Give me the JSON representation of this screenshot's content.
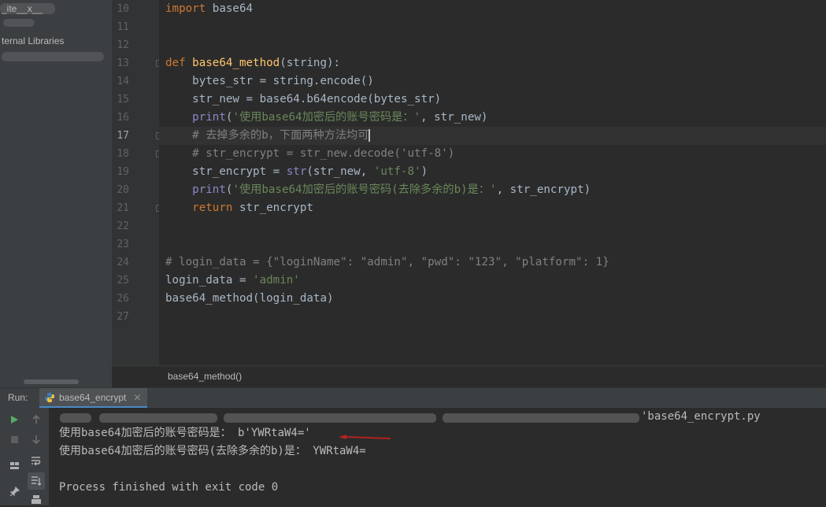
{
  "project_tree": {
    "items": [
      {
        "label": "_ite__x__"
      },
      {
        "label": "ternal Libraries"
      },
      {
        "label": ""
      }
    ]
  },
  "editor": {
    "gutter_numbers": [
      "10",
      "11",
      "12",
      "13",
      "14",
      "15",
      "16",
      "17",
      "18",
      "19",
      "20",
      "21",
      "22",
      "23",
      "24",
      "25",
      "26",
      "27"
    ],
    "current_line": "17",
    "lines": [
      {
        "n": "10",
        "tokens": [
          {
            "t": "import",
            "c": "kw"
          },
          {
            "t": " base64",
            "c": ""
          }
        ]
      },
      {
        "n": "11",
        "tokens": []
      },
      {
        "n": "12",
        "tokens": []
      },
      {
        "n": "13",
        "tokens": [
          {
            "t": "def ",
            "c": "kw"
          },
          {
            "t": "base64_method",
            "c": "fn"
          },
          {
            "t": "(string):",
            "c": ""
          }
        ]
      },
      {
        "n": "14",
        "tokens": [
          {
            "t": "    bytes_str = string.encode()",
            "c": ""
          }
        ]
      },
      {
        "n": "15",
        "tokens": [
          {
            "t": "    str_new = base64.b64encode(bytes_str)",
            "c": ""
          }
        ]
      },
      {
        "n": "16",
        "tokens": [
          {
            "t": "    ",
            "c": ""
          },
          {
            "t": "print",
            "c": "bi"
          },
          {
            "t": "(",
            "c": ""
          },
          {
            "t": "'使用base64加密后的账号密码是：'",
            "c": "str"
          },
          {
            "t": ", str_new)",
            "c": ""
          }
        ]
      },
      {
        "n": "17",
        "tokens": [
          {
            "t": "    # 去掉多余的b，下面两种方法均可",
            "c": "cmt"
          }
        ]
      },
      {
        "n": "18",
        "tokens": [
          {
            "t": "    # str_encrypt = str_new.decode('utf-8')",
            "c": "cmt"
          }
        ]
      },
      {
        "n": "19",
        "tokens": [
          {
            "t": "    str_encrypt = ",
            "c": ""
          },
          {
            "t": "str",
            "c": "bi"
          },
          {
            "t": "(str_new, ",
            "c": ""
          },
          {
            "t": "'utf-8'",
            "c": "str"
          },
          {
            "t": ")",
            "c": ""
          }
        ]
      },
      {
        "n": "20",
        "tokens": [
          {
            "t": "    ",
            "c": ""
          },
          {
            "t": "print",
            "c": "bi"
          },
          {
            "t": "(",
            "c": ""
          },
          {
            "t": "'使用base64加密后的账号密码(去除多余的b)是：'",
            "c": "str"
          },
          {
            "t": ", str_encrypt)",
            "c": ""
          }
        ]
      },
      {
        "n": "21",
        "tokens": [
          {
            "t": "    ",
            "c": ""
          },
          {
            "t": "return",
            "c": "kw"
          },
          {
            "t": " str_encrypt",
            "c": ""
          }
        ]
      },
      {
        "n": "22",
        "tokens": []
      },
      {
        "n": "23",
        "tokens": []
      },
      {
        "n": "24",
        "tokens": [
          {
            "t": "# login_data = {\"loginName\": \"admin\", \"pwd\": \"123\", \"platform\": 1}",
            "c": "cmt"
          }
        ]
      },
      {
        "n": "25",
        "tokens": [
          {
            "t": "login_data = ",
            "c": ""
          },
          {
            "t": "'admin'",
            "c": "str"
          }
        ]
      },
      {
        "n": "26",
        "tokens": [
          {
            "t": "base64_method(login_data)",
            "c": ""
          }
        ]
      },
      {
        "n": "27",
        "tokens": []
      }
    ],
    "breadcrumb": "base64_method()"
  },
  "run_panel": {
    "label": "Run:",
    "tab_label": "base64_encrypt",
    "tab_close": "✕",
    "console": {
      "command_tail": "'base64_encrypt.py",
      "output_line_1": "使用base64加密后的账号密码是： b'YWRtaW4='",
      "output_line_2": "使用base64加密后的账号密码(去除多余的b)是： YWRtaW4=",
      "exit_line": "Process finished with exit code 0"
    }
  },
  "colors": {
    "keyword": "#cc7832",
    "function": "#ffc66d",
    "string": "#6a8759",
    "comment": "#808080",
    "builtin": "#8888c6",
    "annotation_arrow": "#b22222"
  }
}
